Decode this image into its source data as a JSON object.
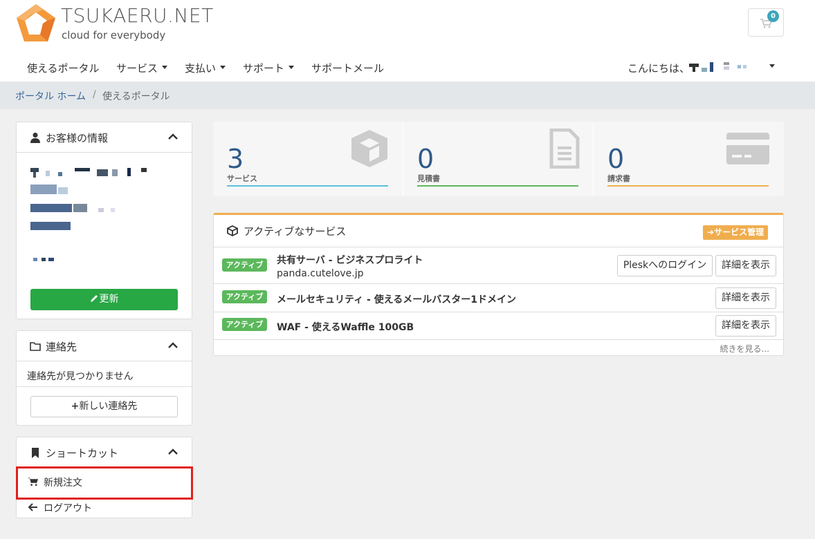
{
  "header": {
    "logo_title": "TSUKAERU.NET",
    "logo_subtitle": "cloud for everybody",
    "cart_count": "0"
  },
  "nav": {
    "items": [
      {
        "label": "使えるポータル"
      },
      {
        "label": "サービス"
      },
      {
        "label": "支払い"
      },
      {
        "label": "サポート"
      },
      {
        "label": "サポートメール"
      }
    ],
    "greeting": "こんにちは、"
  },
  "breadcrumb": {
    "home": "ポータル ホーム",
    "separator": "/",
    "current": "使えるポータル"
  },
  "sidebar": {
    "customer": {
      "title": "お客様の情報",
      "update_label": "更新"
    },
    "contacts": {
      "title": "連絡先",
      "empty_text": "連絡先が見つかりません",
      "new_label": "新しい連絡先"
    },
    "shortcuts": {
      "title": "ショートカット",
      "items": [
        {
          "label": "新規注文",
          "icon": "cart-icon"
        },
        {
          "label": "ログアウト",
          "icon": "arrow-left-icon"
        }
      ]
    }
  },
  "stats": [
    {
      "value": "3",
      "label": "サービス",
      "color": "#5bc0de",
      "icon": "cube-icon"
    },
    {
      "value": "0",
      "label": "見積書",
      "color": "#5cb85c",
      "icon": "document-icon"
    },
    {
      "value": "0",
      "label": "請求書",
      "color": "#f0ad4e",
      "icon": "credit-card-icon"
    }
  ],
  "active_services": {
    "title": "アクティブなサービス",
    "manage_label": "サービス管理",
    "rows": [
      {
        "status": "アクティブ",
        "name": "共有サーバ - ビジネスプロライト",
        "domain": "panda.cutelove.jp",
        "login_label": "Pleskへのログイン",
        "details_label": "詳細を表示"
      },
      {
        "status": "アクティブ",
        "name": "メールセキュリティ - 使えるメールバスター1ドメイン",
        "details_label": "詳細を表示"
      },
      {
        "status": "アクティブ",
        "name": "WAF - 使えるWaffle 100GB",
        "details_label": "詳細を表示"
      }
    ],
    "more_label": "続きを見る..."
  }
}
